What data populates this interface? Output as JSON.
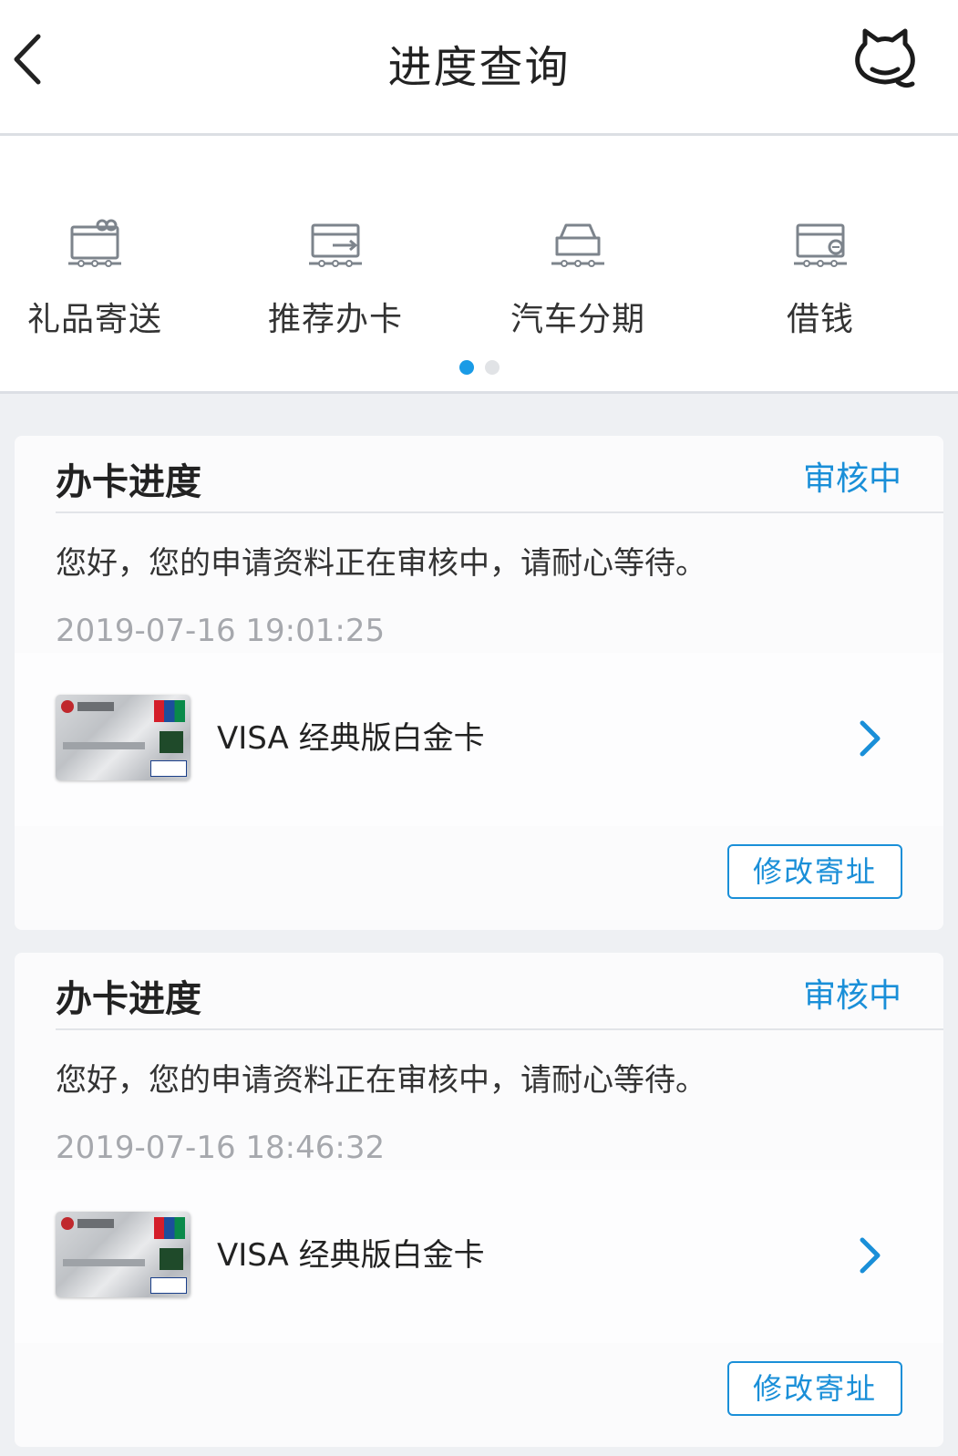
{
  "header": {
    "title": "进度查询"
  },
  "quick_menu": {
    "items": [
      {
        "label": "礼品寄送",
        "icon": "gift-card-icon"
      },
      {
        "label": "推荐办卡",
        "icon": "card-transfer-icon"
      },
      {
        "label": "汽车分期",
        "icon": "car-icon"
      },
      {
        "label": "借钱",
        "icon": "card-loan-icon"
      }
    ],
    "page_count": 2,
    "active_page": 1
  },
  "cards": [
    {
      "title": "办卡进度",
      "status": "审核中",
      "message": "您好，您的申请资料正在审核中，请耐心等待。",
      "timestamp": "2019-07-16 19:01:25",
      "product_name": "VISA 经典版白金卡",
      "edit_button": "修改寄址"
    },
    {
      "title": "办卡进度",
      "status": "审核中",
      "message": "您好，您的申请资料正在审核中，请耐心等待。",
      "timestamp": "2019-07-16 18:46:32",
      "product_name": "VISA 经典版白金卡",
      "edit_button": "修改寄址"
    }
  ],
  "colors": {
    "accent": "#1a8fd8",
    "dot_active": "#1a9be6",
    "background": "#eef0f3"
  }
}
